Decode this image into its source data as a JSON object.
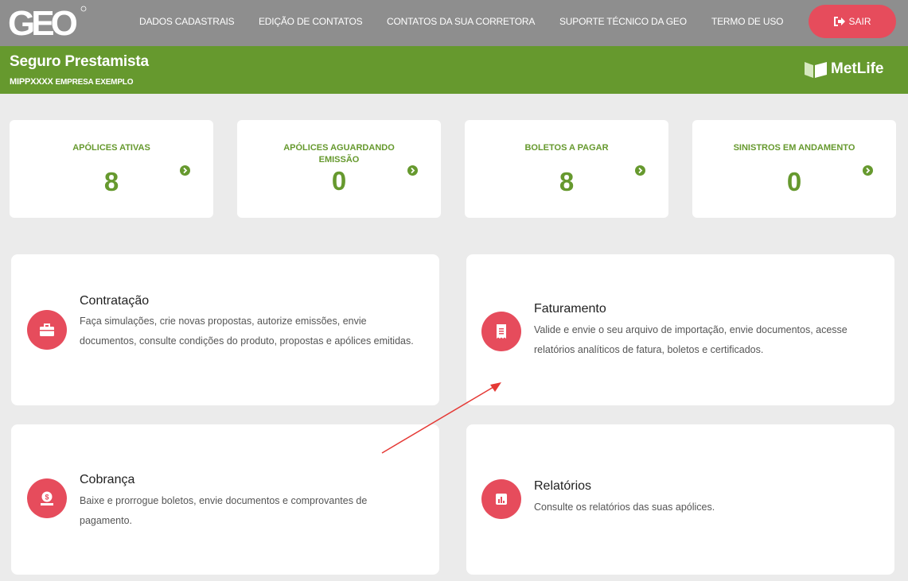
{
  "header": {
    "logo_text": "GEO",
    "nav": [
      "DADOS CADASTRAIS",
      "EDIÇÃO DE CONTATOS",
      "CONTATOS DA SUA CORRETORA",
      "SUPORTE TÉCNICO DA GEO",
      "TERMO DE USO"
    ],
    "logout_label": "SAIR"
  },
  "product": {
    "title": "Seguro Prestamista",
    "subtitle_code": "MIPPXXXX",
    "subtitle_company": "EMPRESA EXEMPLO",
    "partner": "MetLife"
  },
  "stats": [
    {
      "label": "APÓLICES ATIVAS",
      "value": "8"
    },
    {
      "label": "APÓLICES AGUARDANDO EMISSÃO",
      "value": "0"
    },
    {
      "label": "BOLETOS A PAGAR",
      "value": "8"
    },
    {
      "label": "SINISTROS EM ANDAMENTO",
      "value": "0"
    }
  ],
  "features": [
    {
      "title": "Contratação",
      "description": "Faça simulações, crie novas propostas, autorize emissões, envie documentos, consulte condições do produto, propostas e apólices emitidas.",
      "icon": "briefcase-icon"
    },
    {
      "title": "Faturamento",
      "description": "Valide e envie o seu arquivo de importação, envie documentos, acesse relatórios analíticos de fatura, boletos e certificados.",
      "icon": "receipt-icon"
    },
    {
      "title": "Cobrança",
      "description": "Baixe e prorrogue boletos, envie documentos e comprovantes de pagamento.",
      "icon": "money-bag-icon"
    },
    {
      "title": "Relatórios",
      "description": "Consulte os relatórios das suas apólices.",
      "icon": "bar-chart-icon"
    }
  ],
  "colors": {
    "topbar": "#8e8e8e",
    "brand_green": "#66992e",
    "accent_red": "#e64c5c",
    "background": "#ebebeb"
  }
}
